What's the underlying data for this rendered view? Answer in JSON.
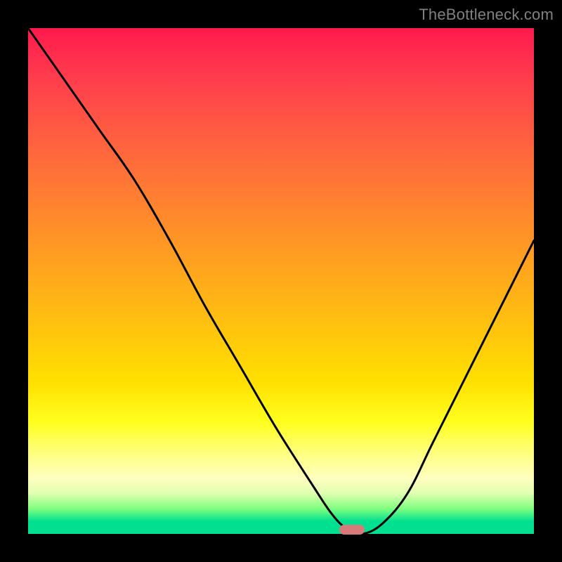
{
  "watermark": "TheBottleneck.com",
  "colors": {
    "frame": "#000000",
    "curve_stroke": "#000000",
    "marker": "#d97a7a",
    "watermark_text": "#808080",
    "gradient_top": "#ff1a4d",
    "gradient_bottom": "#00e090"
  },
  "chart_data": {
    "type": "line",
    "title": "",
    "xlabel": "",
    "ylabel": "",
    "xlim": [
      0,
      100
    ],
    "ylim": [
      0,
      100
    ],
    "grid": false,
    "axes_visible": false,
    "series": [
      {
        "name": "bottleneck-curve",
        "x": [
          0,
          7,
          14,
          21,
          28,
          35,
          42,
          49,
          56,
          60,
          63,
          66,
          70,
          75,
          80,
          86,
          93,
          100
        ],
        "values": [
          100,
          90,
          80,
          70,
          58,
          45,
          33,
          21,
          10,
          4,
          1,
          0,
          2,
          8,
          18,
          30,
          44,
          58
        ]
      }
    ],
    "marker": {
      "x": 64,
      "y": 0
    },
    "legend": false
  }
}
